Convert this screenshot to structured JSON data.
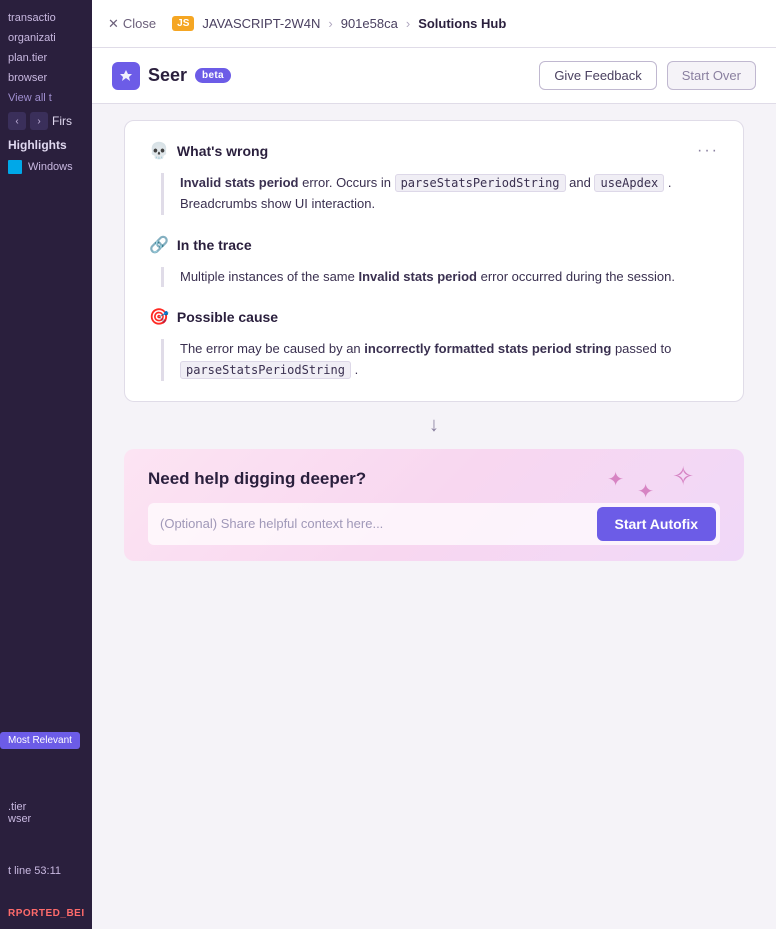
{
  "breadcrumb": {
    "close_label": "Close",
    "js_badge": "JS",
    "issue_id": "JAVASCRIPT-2W4N",
    "commit": "901e58ca",
    "page": "Solutions Hub"
  },
  "header": {
    "app_name": "Seer",
    "beta_label": "beta",
    "give_feedback_label": "Give Feedback",
    "start_over_label": "Start Over"
  },
  "analysis": {
    "whats_wrong": {
      "title": "What's wrong",
      "body_text_1": "error. Occurs in",
      "bold_prefix": "Invalid stats period",
      "code_1": "parseStatsPeriodString",
      "conjunction": "and",
      "code_2": "useApdex",
      "body_text_2": ". Breadcrumbs show UI interaction."
    },
    "in_the_trace": {
      "title": "In the trace",
      "body_text": "Multiple instances of the same",
      "bold_text": "Invalid stats period",
      "body_text_2": "error occurred during the session."
    },
    "possible_cause": {
      "title": "Possible cause",
      "body_text_1": "The error may be caused by an",
      "bold_text": "incorrectly formatted stats period string",
      "body_text_2": "passed to",
      "code_1": "parseStatsPeriodString",
      "body_text_3": "."
    }
  },
  "help_box": {
    "title": "Need help digging deeper?",
    "input_placeholder": "(Optional) Share helpful context here...",
    "autofix_label": "Start Autofix"
  },
  "sidebar": {
    "items": [
      "transactio",
      "organizati",
      "plan.tier",
      "browser"
    ],
    "view_all": "View all t",
    "nav_label": "Firs",
    "highlights_label": "Highlights",
    "windows_label": "Windows",
    "bottom_items": [
      ".tier",
      "wser"
    ],
    "most_relevant": "Most Relevant",
    "line_info": "t line  53:11",
    "error_badge": "RPORTED_BEI"
  }
}
